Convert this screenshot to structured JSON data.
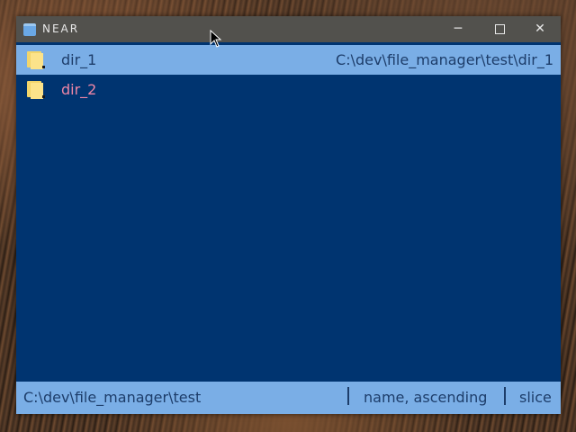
{
  "window": {
    "title": "NEAR",
    "controls": {
      "minimize": "─",
      "close": "✕"
    }
  },
  "list": {
    "items": [
      {
        "name": "dir_1",
        "path": "C:\\dev\\file_manager\\test\\dir_1",
        "selected": true,
        "icon": "folder-icon"
      },
      {
        "name": "dir_2",
        "path": "",
        "selected": false,
        "icon": "folder-icon"
      }
    ]
  },
  "statusbar": {
    "path": "C:\\dev\\file_manager\\test",
    "sort": "name, ascending",
    "mode": "slice"
  },
  "colors": {
    "panel_bg": "#003470",
    "selection_bg": "#7aaee6",
    "selected_text": "#1d3d6a",
    "other_text": "#ee86a6",
    "titlebar_bg": "#52514d"
  }
}
